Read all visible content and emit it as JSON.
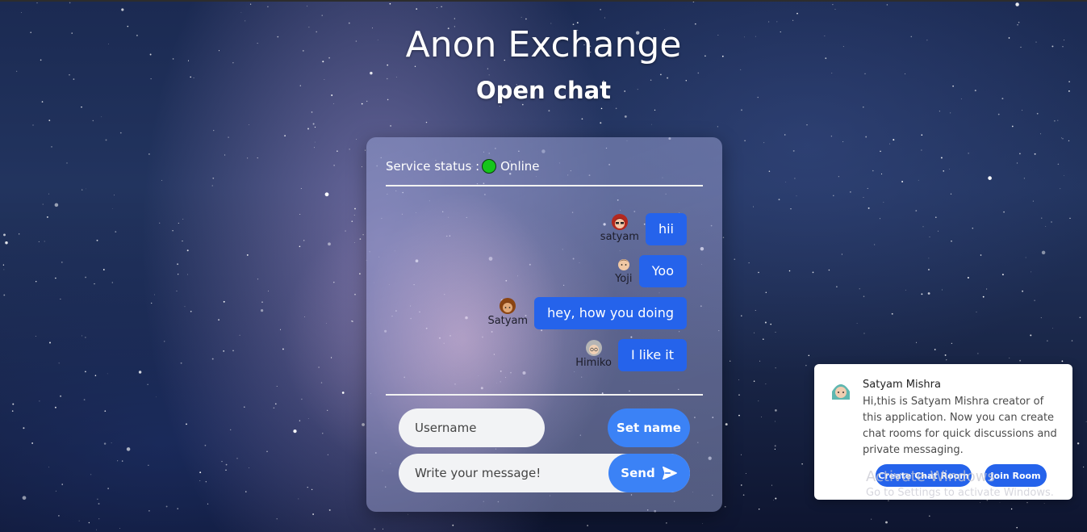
{
  "header": {
    "title": "Anon Exchange",
    "subtitle": "Open chat"
  },
  "chat": {
    "status_label": "Service status :",
    "status_value": "Online",
    "status_color": "#15c51a",
    "messages": [
      {
        "user": "satyam",
        "text": "hii",
        "avatar_icon": "red-hair-avatar-icon"
      },
      {
        "user": "Yoji",
        "text": "Yoo",
        "avatar_icon": "boy-avatar-icon"
      },
      {
        "user": "Satyam",
        "text": "hey, how you doing",
        "avatar_icon": "brown-hair-avatar-icon"
      },
      {
        "user": "Himiko",
        "text": "I like it",
        "avatar_icon": "grey-hair-avatar-icon"
      }
    ],
    "username_placeholder": "Username",
    "set_name_label": "Set name",
    "message_placeholder": "Write your message!",
    "send_label": "Send",
    "accent_color": "#2563eb"
  },
  "notification": {
    "sender": "Satyam Mishra",
    "text": "Hi,this is Satyam Mishra creator of this application. Now you can create chat rooms for quick discussions and private messaging.",
    "create_room_label": "Create Chat Room",
    "join_room_label": "Join Room"
  },
  "watermark": {
    "line1": "Activate Windows",
    "line2": "Go to Settings to activate Windows."
  }
}
